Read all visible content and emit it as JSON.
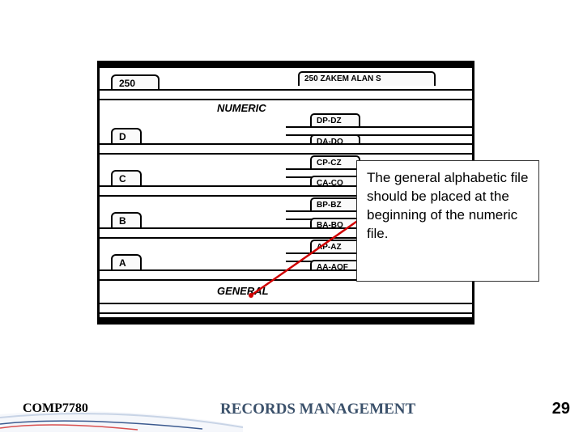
{
  "footer": {
    "course": "COMP7780",
    "title": "RECORDS MANAGEMENT",
    "page": "29"
  },
  "callout": {
    "text": "The general alphabetic file should be placed at the beginning of the numeric file."
  },
  "sections": {
    "numeric": "NUMERIC",
    "general": "GENERAL"
  },
  "primary": {
    "n250": "250",
    "folder250": "250   ZAKEM ALAN S",
    "D": "D",
    "C": "C",
    "B": "B",
    "A": "A"
  },
  "guides": {
    "dpdz": "DP-DZ",
    "dado": "DA-DO",
    "cpcz": "CP-CZ",
    "caco": "CA-CO",
    "bpbz": "BP-BZ",
    "babo": "BA-BO",
    "apaz": "AP-AZ",
    "aaaof": "AA-AOF"
  }
}
